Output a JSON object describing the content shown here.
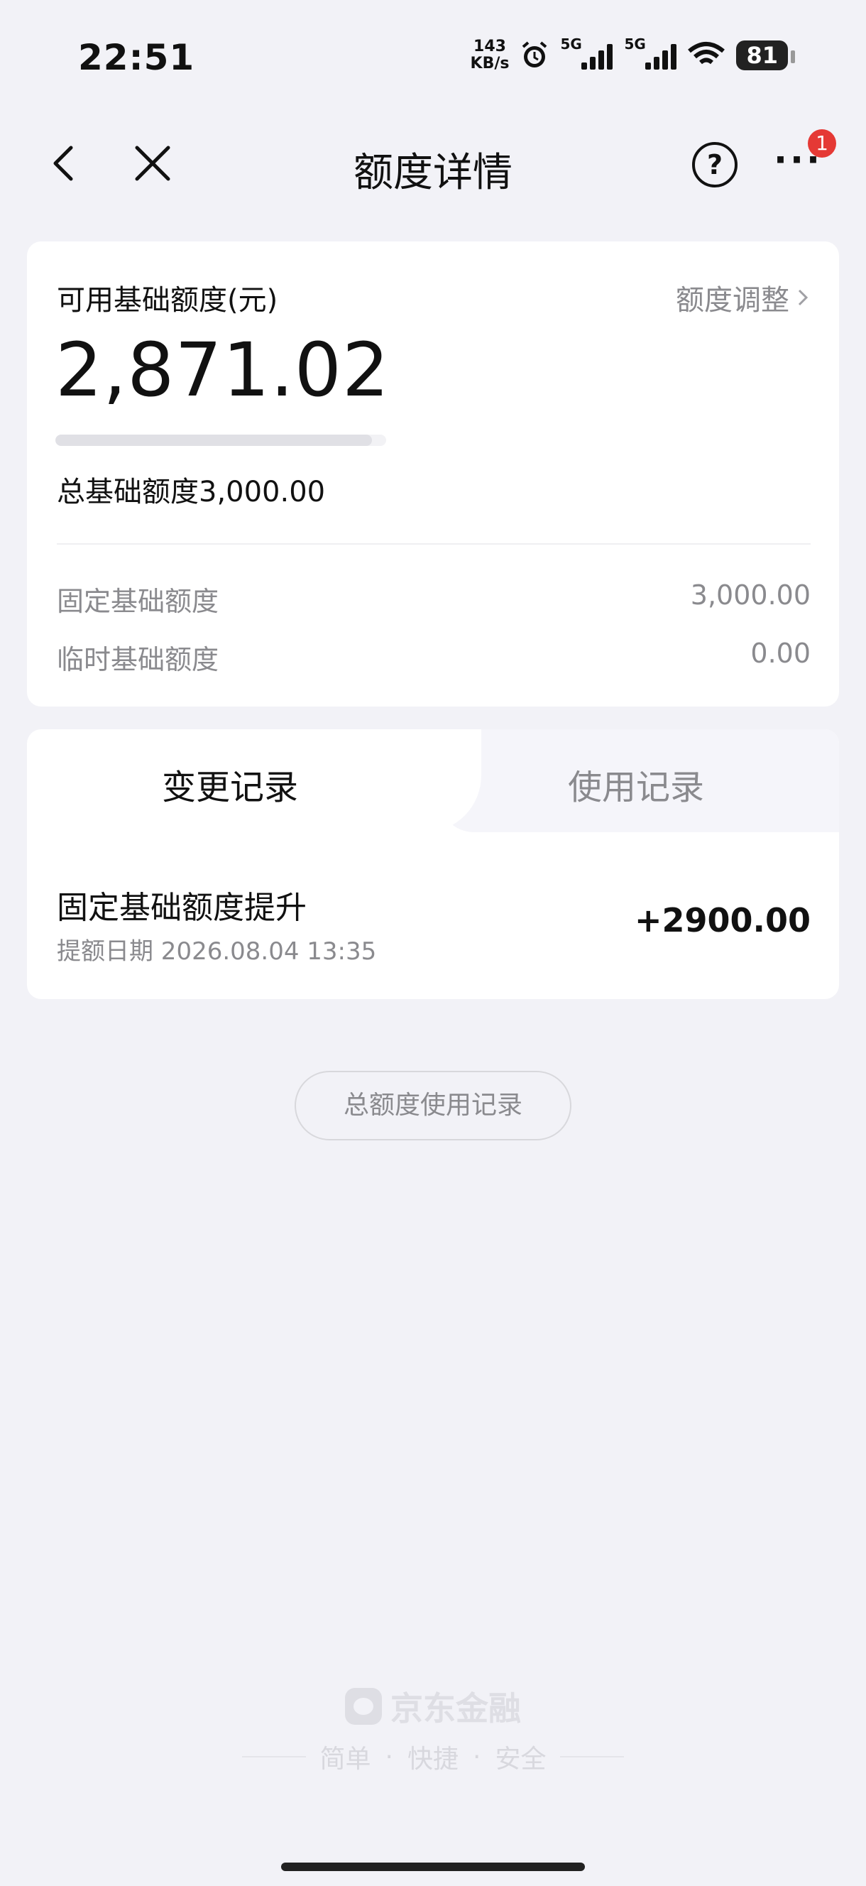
{
  "status_bar": {
    "time": "22:51",
    "speed_value": "143",
    "speed_unit": "KB/s",
    "network_1": "5G",
    "network_2": "5G",
    "battery": "81",
    "icons": [
      "alarm-icon",
      "signal-icon",
      "wifi-icon",
      "battery-icon"
    ]
  },
  "nav": {
    "title": "额度详情",
    "badge_count": "1",
    "help_glyph": "?",
    "more_glyph": "···"
  },
  "credit": {
    "available_label": "可用基础额度(元)",
    "adjust_label": "额度调整",
    "available_amount": "2,871.02",
    "usage_fraction": 0.957,
    "total_label": "总基础额度3,000.00",
    "rows": [
      {
        "label": "固定基础额度",
        "value": "3,000.00"
      },
      {
        "label": "临时基础额度",
        "value": "0.00"
      }
    ]
  },
  "records": {
    "tabs": [
      {
        "label": "变更记录",
        "active": true
      },
      {
        "label": "使用记录",
        "active": false
      }
    ],
    "items": [
      {
        "title": "固定基础额度提升",
        "date": "提额日期 2026.08.04 13:35",
        "amount": "+2900.00"
      }
    ]
  },
  "total_usage_button": "总额度使用记录",
  "footer": {
    "brand": "京东金融",
    "slogan_items": [
      "简单",
      "快捷",
      "安全"
    ],
    "separator": "·"
  },
  "colors": {
    "background": "#f2f2f7",
    "card": "#ffffff",
    "secondary_text": "#8a8a8e",
    "badge": "#e53935"
  }
}
